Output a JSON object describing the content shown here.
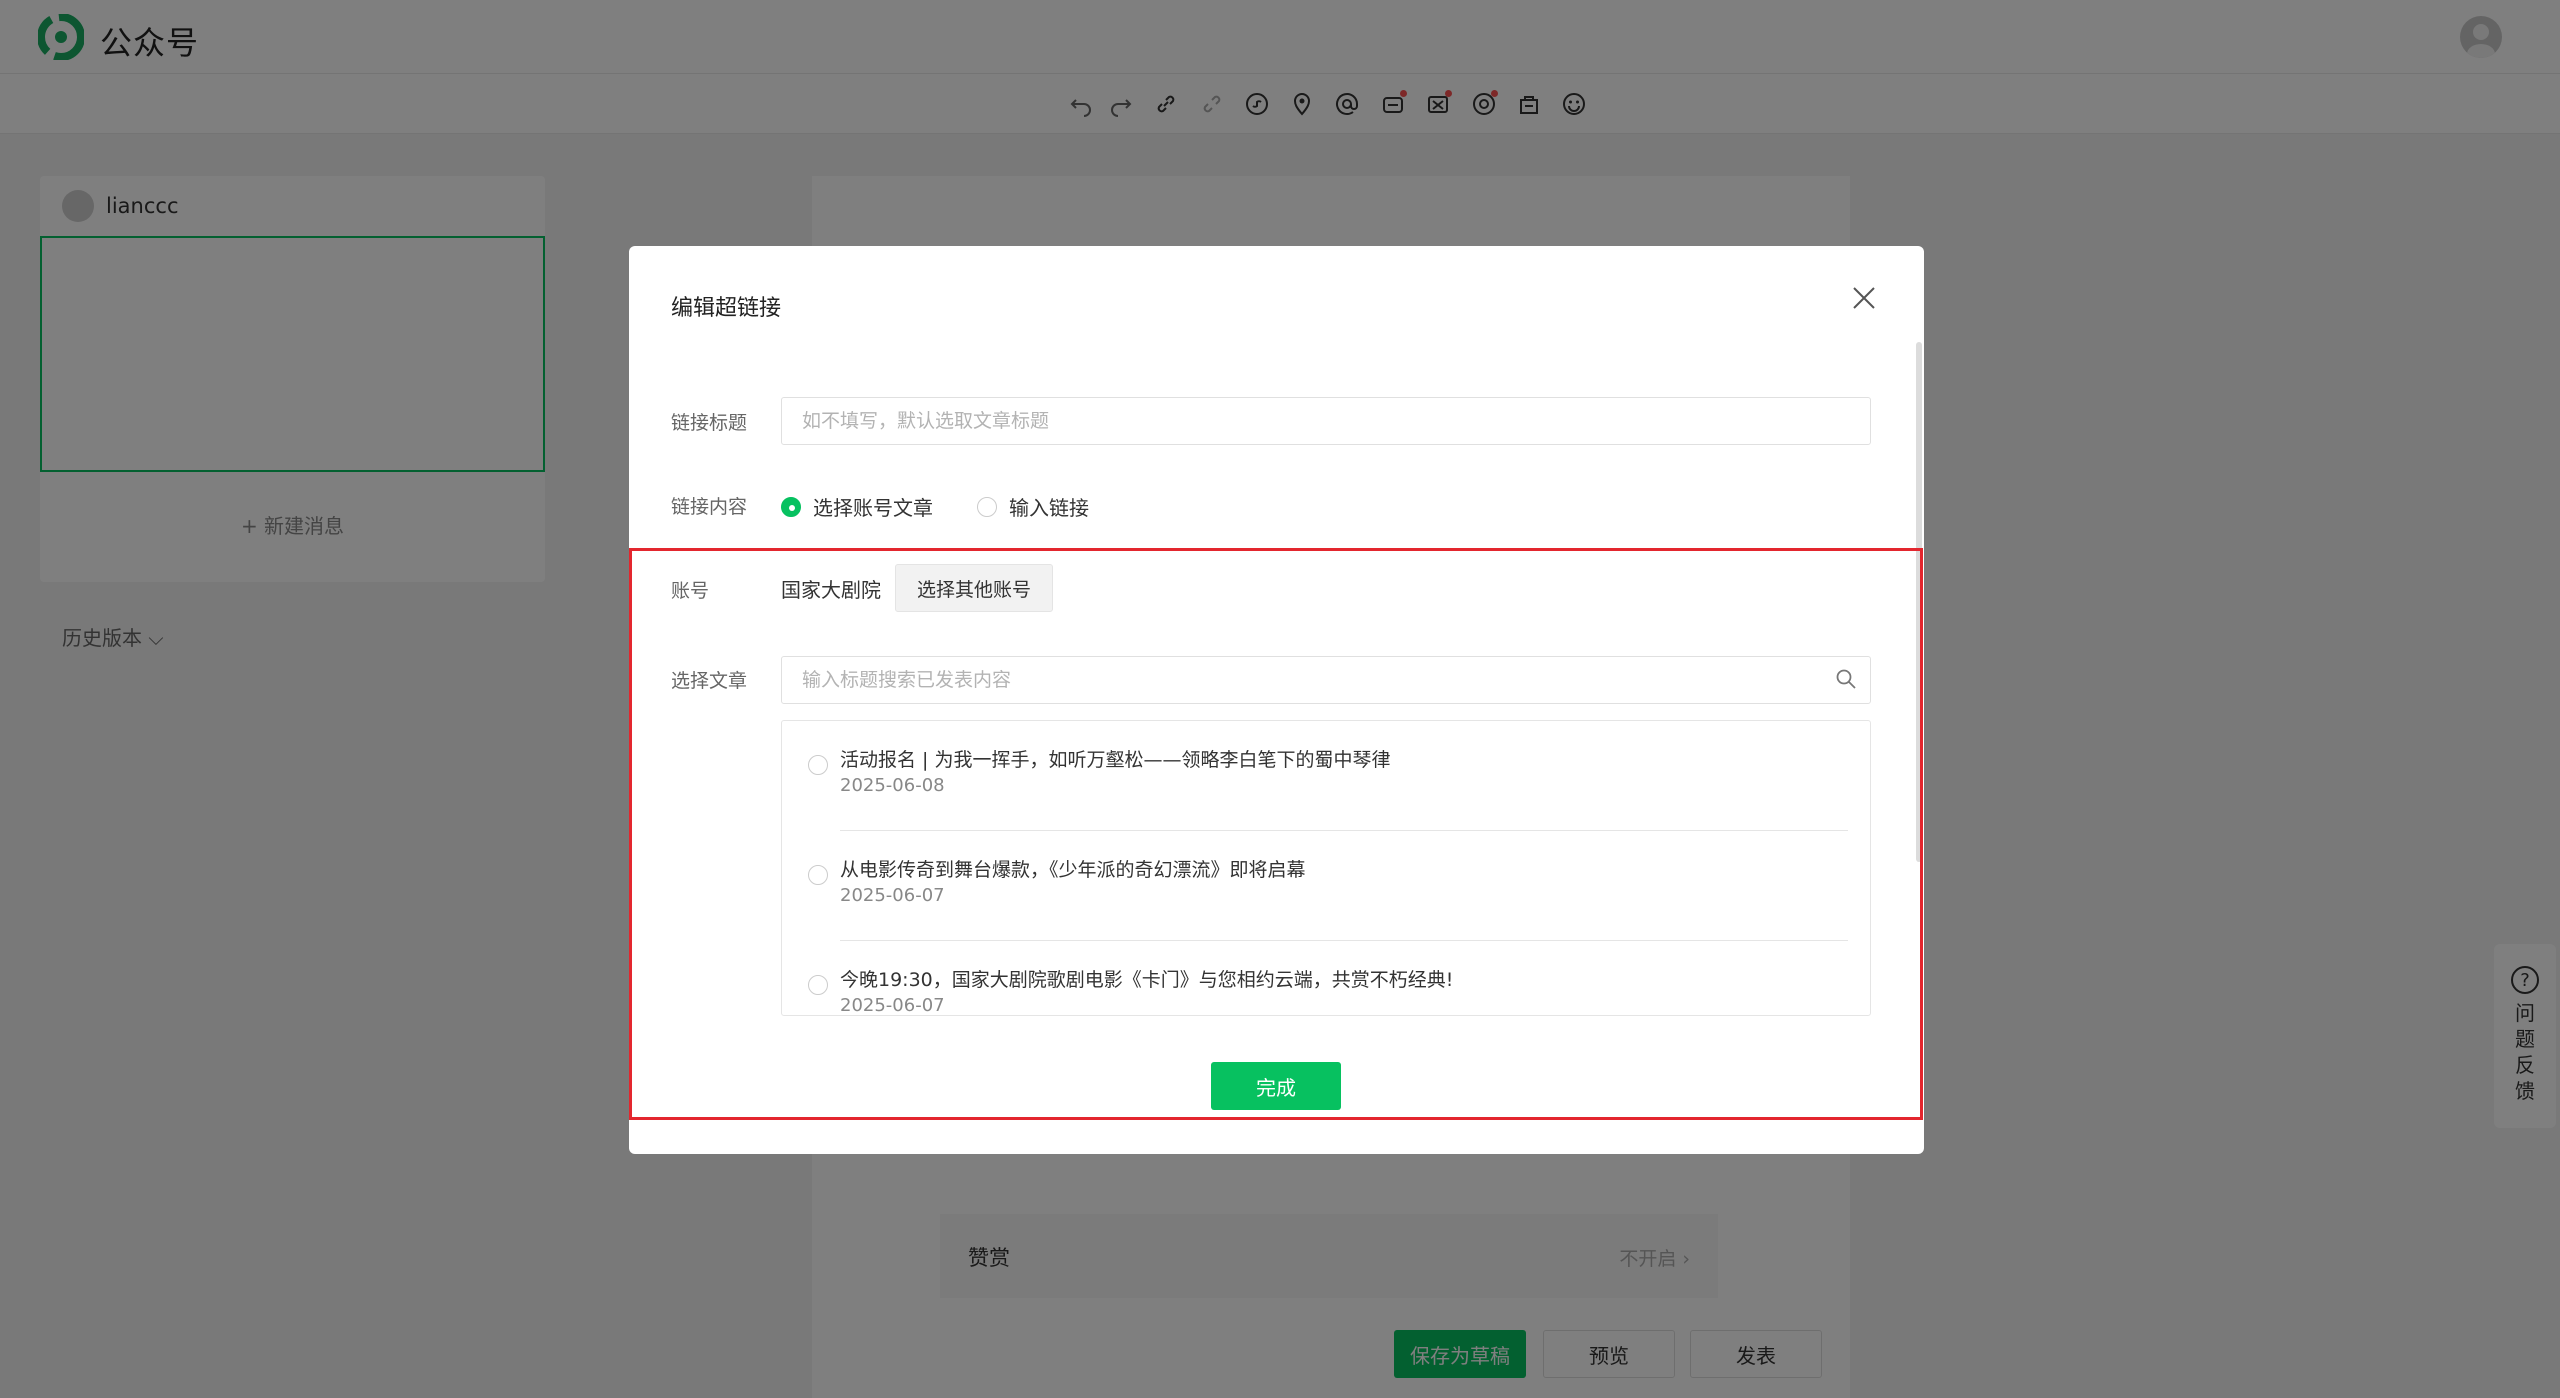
{
  "app": {
    "title": "公众号"
  },
  "toolbar": {
    "tools": [
      "undo-icon",
      "redo-icon",
      "link-icon",
      "unlink-icon",
      "mini-program-icon",
      "location-icon",
      "at-icon",
      "ad-icon",
      "video-number-icon",
      "audio-icon",
      "product-icon",
      "emoji-icon"
    ]
  },
  "sidebar": {
    "account_name": "lianccc",
    "new_message": "+ 新建消息",
    "history": "历史版本 ⌵"
  },
  "editor": {
    "reward_label": "赞赏",
    "reward_value": "不开启 ›",
    "save_draft": "保存为草稿",
    "preview": "预览",
    "publish": "发表"
  },
  "feedback": {
    "icon": "?",
    "text": "问题反馈"
  },
  "modal": {
    "title": "编辑超链接",
    "link_title_label": "链接标题",
    "link_title_placeholder": "如不填写，默认选取文章标题",
    "link_content_label": "链接内容",
    "option_select_article": "选择账号文章",
    "option_input_link": "输入链接",
    "account_label": "账号",
    "account_name": "国家大剧院",
    "choose_other_account": "选择其他账号",
    "select_article_label": "选择文章",
    "search_placeholder": "输入标题搜索已发表内容",
    "articles": [
      {
        "title": "活动报名 | 为我一挥手，如听万壑松——领略李白笔下的蜀中琴律",
        "date": "2025-06-08"
      },
      {
        "title": "从电影传奇到舞台爆款，《少年派的奇幻漂流》即将启幕",
        "date": "2025-06-07"
      },
      {
        "title": "今晚19:30，国家大剧院歌剧电影《卡门》与您相约云端，共赏不朽经典!",
        "date": "2025-06-07"
      }
    ],
    "done": "完成"
  },
  "colors": {
    "brand": "#07c160",
    "highlight": "#e3262e"
  }
}
